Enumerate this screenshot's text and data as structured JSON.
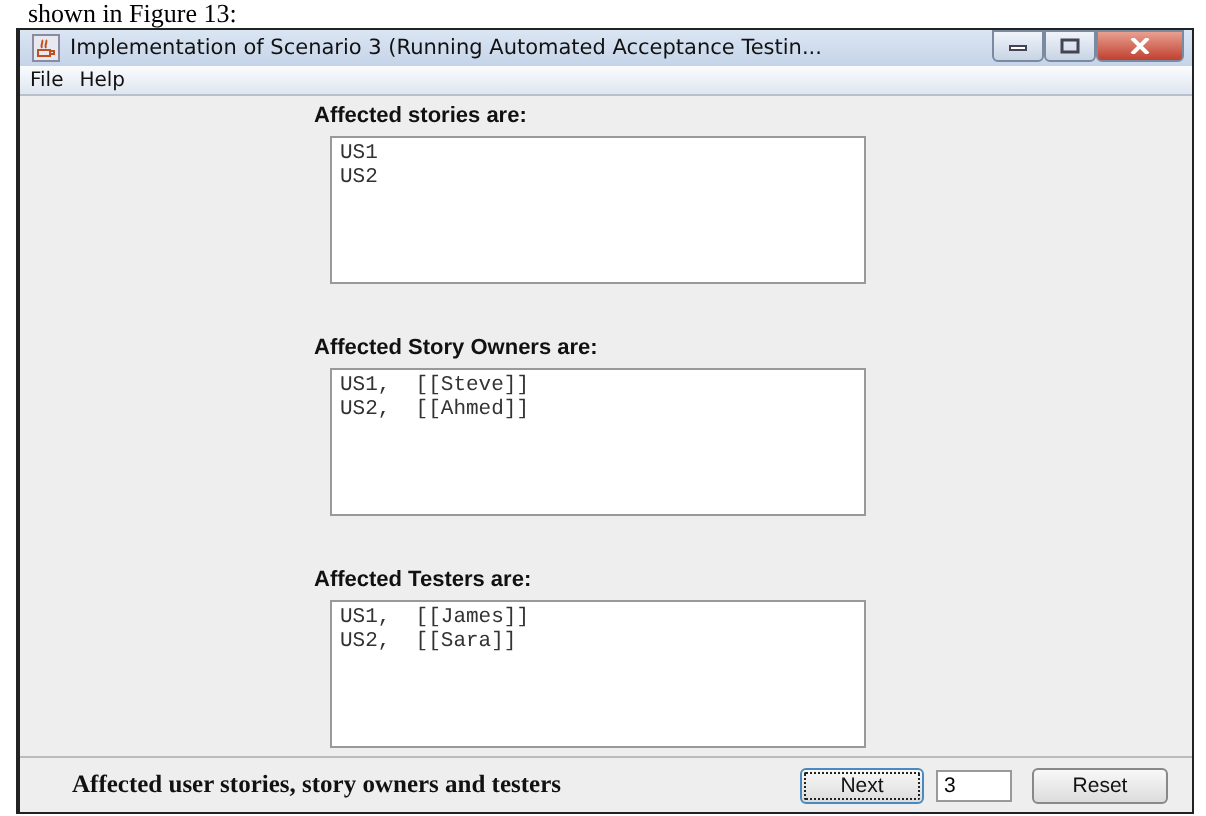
{
  "caption": "shown in Figure 13:",
  "window": {
    "title": "Implementation of Scenario 3 (Running Automated Acceptance Testin..."
  },
  "menu": [
    "File",
    "Help"
  ],
  "sections": [
    {
      "label": "Affected stories are:",
      "lines": [
        "US1",
        "US2"
      ]
    },
    {
      "label": "Affected Story Owners are:",
      "lines": [
        "US1,  [[Steve]]",
        "US2,  [[Ahmed]]"
      ]
    },
    {
      "label": "Affected Testers are:",
      "lines": [
        "US1,  [[James]]",
        "US2,  [[Sara]]"
      ]
    }
  ],
  "footer": {
    "text": "Affected user stories, story owners and testers",
    "next": {
      "label": "Next",
      "focused": true
    },
    "field": "3",
    "reset": "Reset"
  }
}
